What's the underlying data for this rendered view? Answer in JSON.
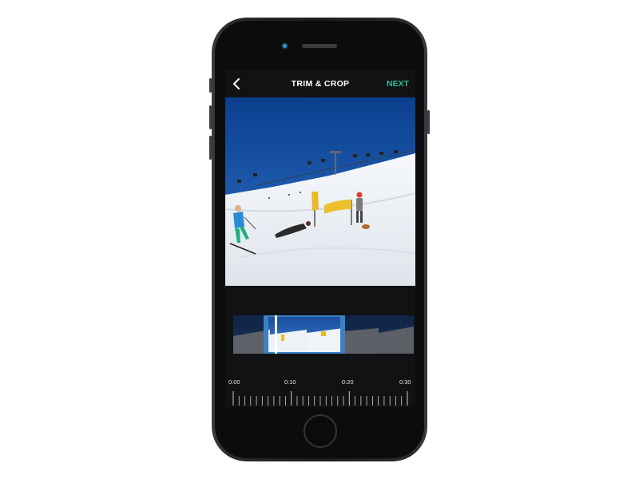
{
  "nav": {
    "back_icon": "chevron-left-icon",
    "title": "TRIM & CROP",
    "next_label": "NEXT"
  },
  "timeline": {
    "labels": [
      "0:00",
      "0:10",
      "0:20",
      "0:30"
    ]
  },
  "trim": {
    "selection_start_fraction": 0.17,
    "selection_end_fraction": 0.62,
    "playhead_fraction": 0.23
  },
  "colors": {
    "accent_next": "#2ac193",
    "trim_handle": "#3b82c4",
    "screen_bg": "#111214"
  }
}
